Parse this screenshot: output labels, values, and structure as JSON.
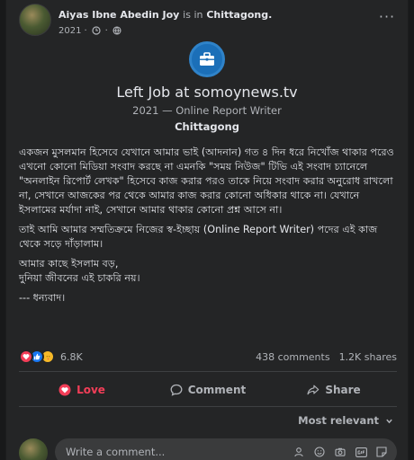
{
  "post": {
    "author": "Aiyas Ibne Abedin Joy",
    "is_in_text": "is in",
    "place": "Chittagong.",
    "year": "2021",
    "separator": "·",
    "more_label": "···"
  },
  "life_event": {
    "title": "Left Job at somoynews.tv",
    "subtitle": "2021 — Online Report Writer",
    "location": "Chittagong",
    "icon": "briefcase-icon",
    "icon_color": "#1b6fb8"
  },
  "body": {
    "p1": "একজন মুসলমান হিসেবে যেখানে আমার ভাই (আদনান) গত ৪ দিন ধরে নিখোঁজ থাকার পরেও এখনো কোনো মিডিয়া সংবাদ করছে না এমনকি \"সময় নিউজ\" টিভি এই সংবাদ চ্যানেলে \"অনলাইন রিপোর্ট লেখক\" হিসেবে কাজ করার পরও তাকে নিয়ে সংবাদ করার অনুরোধ রাখলো না, সেখানে আজকের পর থেকে আমার কাজ করার কোনো অধিকার থাকে না। যেখানে ইসলামের মর্যাদা নাই, সেখানে আমার থাকার কোনো প্রশ্ন আসে না।",
    "p2": "তাই আমি আমার সম্মতিক্রমে নিজের স্ব-ইচ্ছায় (Online Report Writer) পদের এই কাজ থেকে সড়ে দাঁড়ালাম।",
    "p3": "আমার কাছে ইসলাম বড়,\nদুনিয়া জীবনের এই চাকরি নয়।",
    "p4": "--- ধন্যবাদ।"
  },
  "stats": {
    "reaction_count": "6.8K",
    "comments": "438 comments",
    "shares": "1.2K shares"
  },
  "actions": {
    "love": "Love",
    "comment": "Comment",
    "share": "Share",
    "love_color": "#f33e58"
  },
  "comments": {
    "sort_label": "Most relevant",
    "placeholder": "Write a comment..."
  }
}
